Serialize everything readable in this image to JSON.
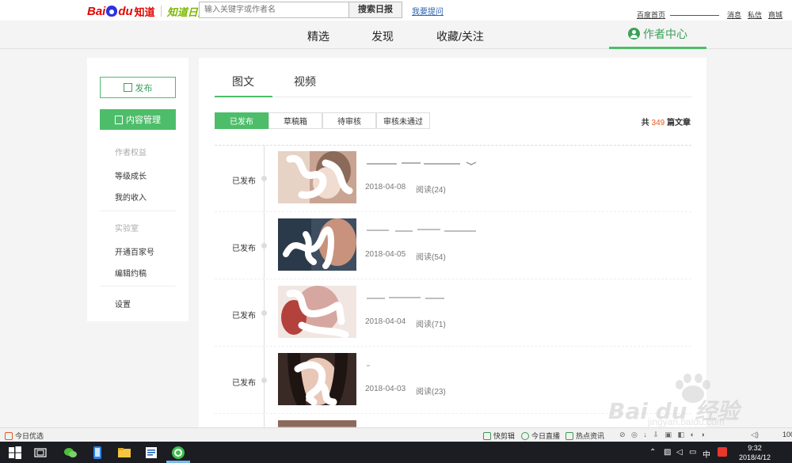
{
  "topbar": {
    "logo": {
      "bai": "Bai",
      "du": "du",
      "zhidao": "知道",
      "ribao": "知道日报"
    },
    "search_placeholder": "输入关键字或作者名",
    "search_button": "搜索日报",
    "ask_link": "我要提问",
    "links": {
      "home": "百度首页",
      "messages": "消息",
      "private_msg": "私信",
      "mall": "商城"
    }
  },
  "nav": {
    "items": [
      "精选",
      "发现",
      "收藏/关注"
    ],
    "author_center": "作者中心",
    "accent": "#4dbd6a"
  },
  "sidebar": {
    "publish": "发布",
    "content_manage": "内容管理",
    "section_rights": "作者权益",
    "level_growth": "等级成长",
    "my_income": "我的收入",
    "section_lab": "实验室",
    "open_baijiahao": "开通百家号",
    "edit_invite": "编辑约稿",
    "settings": "设置"
  },
  "main": {
    "tabs": [
      "图文",
      "视频"
    ],
    "filters": [
      "已发布",
      "草稿箱",
      "待审核",
      "审核未通过"
    ],
    "total": {
      "prefix": "共",
      "count": "349",
      "suffix": "篇文章"
    },
    "articles": [
      {
        "status": "已发布",
        "date": "2018-04-08",
        "reads": "阅读(24)"
      },
      {
        "status": "已发布",
        "date": "2018-04-05",
        "reads": "阅读(54)"
      },
      {
        "status": "已发布",
        "date": "2018-04-04",
        "reads": "阅读(71)"
      },
      {
        "status": "已发布",
        "date": "2018-04-03",
        "reads": "阅读(23)"
      }
    ]
  },
  "statusbar": {
    "today_pick": "今日优选",
    "clip": "快剪辑",
    "live": "今日直播",
    "hot": "热点资讯",
    "zoom": "100"
  },
  "taskbar": {
    "ime": "中",
    "time": "9:32",
    "date": "2018/4/12"
  },
  "watermark": {
    "text": "Bai du 经验",
    "url": "jingyan.baidu.com"
  }
}
